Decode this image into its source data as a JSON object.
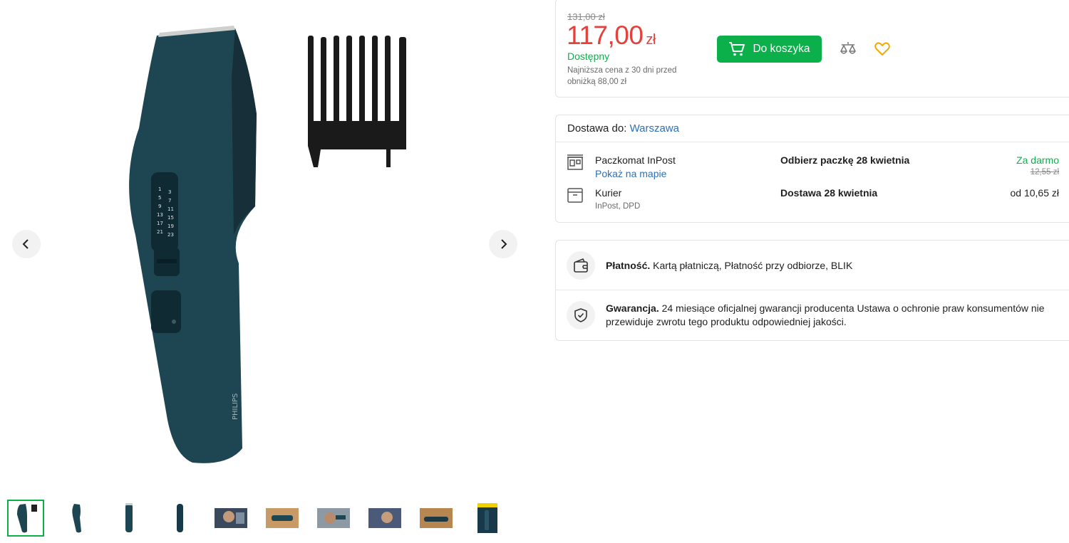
{
  "gallery": {
    "main_image": "hair-clipper-with-comb-attachment",
    "brand_text": "PHILIPS",
    "dial_numbers_left": [
      "1",
      "5",
      "9",
      "13",
      "17",
      "21"
    ],
    "dial_numbers_right": [
      "3",
      "7",
      "11",
      "15",
      "19",
      "23"
    ],
    "thumbnails": [
      {
        "icon": "clipper-with-comb"
      },
      {
        "icon": "clipper-side"
      },
      {
        "icon": "clipper-front"
      },
      {
        "icon": "clipper-back"
      },
      {
        "icon": "man-photo"
      },
      {
        "icon": "clipper-on-table"
      },
      {
        "icon": "trimming-photo"
      },
      {
        "icon": "man-photo-2"
      },
      {
        "icon": "clipper-in-hand"
      },
      {
        "icon": "product-box"
      }
    ]
  },
  "price": {
    "old": "131,00 zł",
    "current": "117,00",
    "currency": "zł",
    "availability": "Dostępny",
    "lowest_note": "Najniższa cena z 30 dni przed obniżką 88,00 zł",
    "cart_button": "Do koszyka"
  },
  "delivery": {
    "label": "Dostawa do:",
    "city": "Warszawa",
    "options": [
      {
        "name": "Paczkomat InPost",
        "link": "Pokaż na mapie",
        "when": "Odbierz paczkę 28 kwietnia",
        "cost": "Za darmo",
        "old_cost": "12,55 zł"
      },
      {
        "name": "Kurier",
        "sub": "InPost, DPD",
        "when": "Dostawa 28 kwietnia",
        "cost": "od 10,65 zł"
      }
    ]
  },
  "info": {
    "payment_label": "Płatność.",
    "payment_text": "Kartą płatniczą, Płatność przy odbiorze, BLIK",
    "warranty_label": "Gwarancja.",
    "warranty_text": "24 miesiące oficjalnej gwarancji producenta Ustawa o ochronie praw konsumentów nie przewiduje zwrotu tego produktu odpowiedniej jakości."
  },
  "colors": {
    "accent": "#0cb04a",
    "price": "#e5413c",
    "link": "#2f6fb5",
    "favorite": "#f2a900",
    "product": "#1d4552"
  }
}
